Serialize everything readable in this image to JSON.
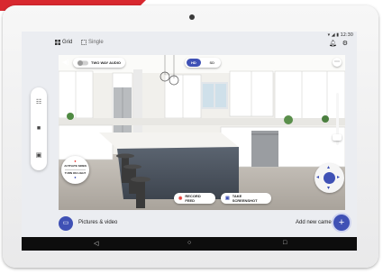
{
  "status_bar": {
    "time": "12:30"
  },
  "view_tabs": [
    {
      "label": "Grid",
      "icon": "grid-icon",
      "selected": true
    },
    {
      "label": "Single",
      "icon": "single-view-icon",
      "selected": false
    }
  ],
  "header_icons": [
    "bell-icon",
    "gear-icon"
  ],
  "side_controls": [
    "grid-icon",
    "camera-icon",
    "doorbell-icon"
  ],
  "feed": {
    "audio_label": "TWO WAY AUDIO",
    "quality_options": [
      "HD",
      "SD"
    ],
    "quality_selected": "HD",
    "siren_label": "ACTIVATE SIREN",
    "light_label": "TURN ON LIGHT",
    "record_label": "RECORD FEED",
    "screenshot_label": "TAKE SCREENSHOT"
  },
  "bottom": {
    "pictures_label": "Pictures & video",
    "add_camera_label": "Add new camera"
  },
  "nav_icons": [
    "back-icon",
    "home-icon",
    "recents-icon"
  ],
  "colors": {
    "accent": "#3f51b5",
    "record": "#e53935",
    "frame_red": "#d8282f"
  }
}
